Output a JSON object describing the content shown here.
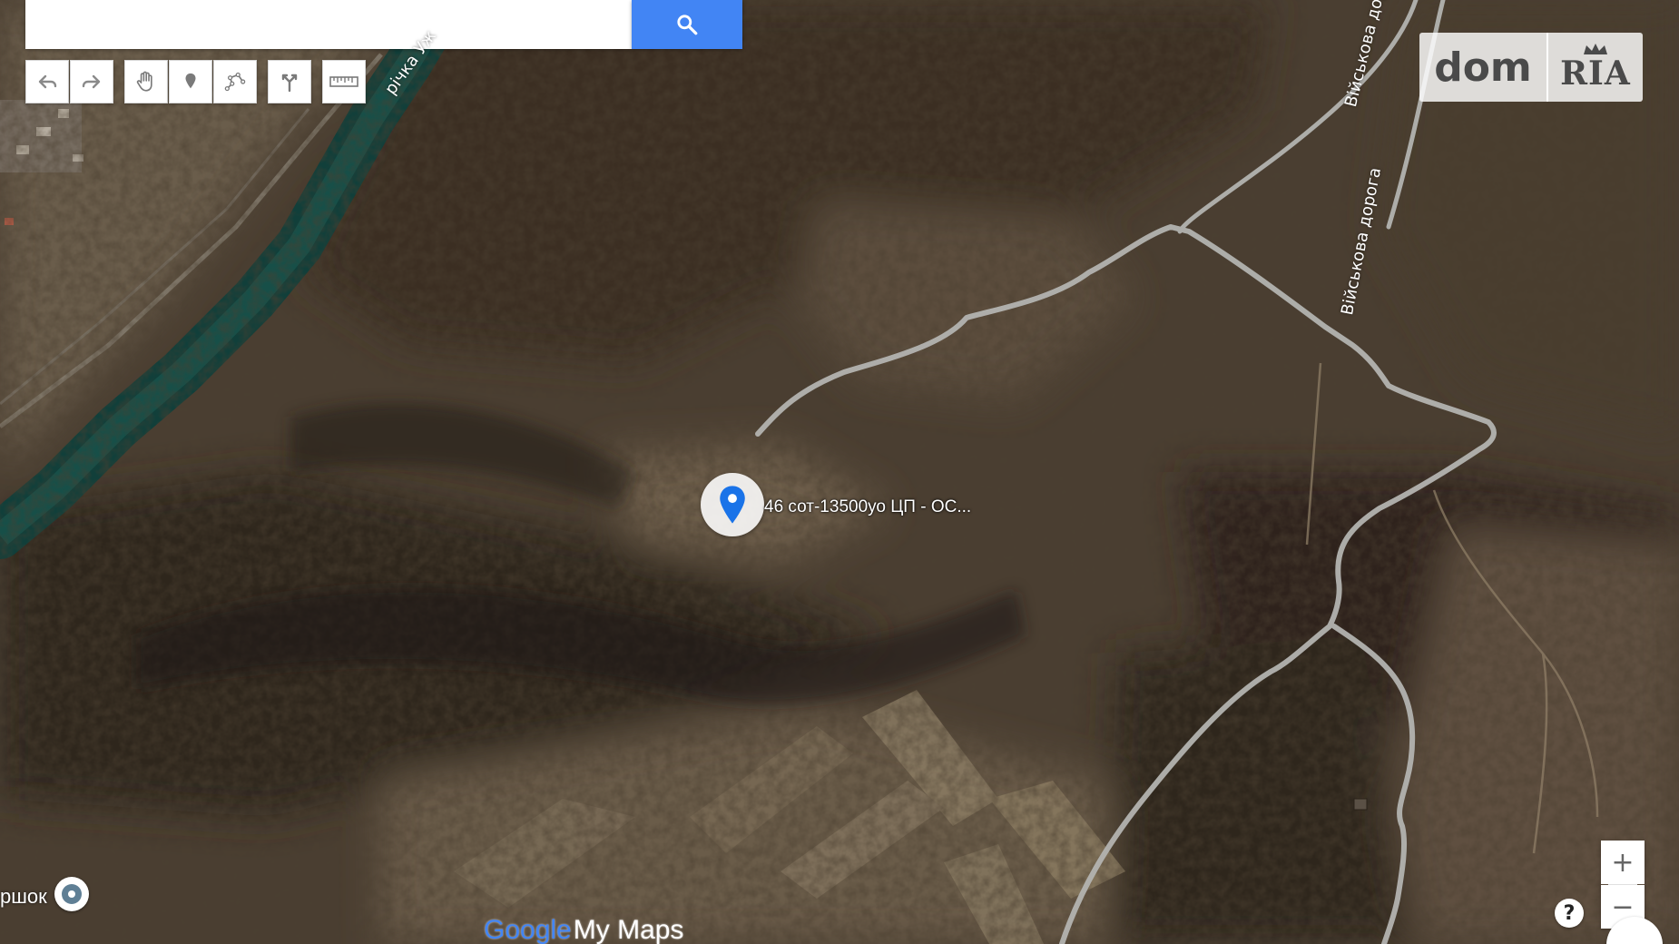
{
  "search": {
    "value": "",
    "placeholder": ""
  },
  "toolbar": {
    "buttons": [
      {
        "name": "undo",
        "icon": "undo-arrow-icon"
      },
      {
        "name": "redo",
        "icon": "redo-arrow-icon"
      },
      {
        "name": "pan",
        "icon": "hand-icon"
      },
      {
        "name": "add-marker",
        "icon": "marker-icon"
      },
      {
        "name": "draw-line",
        "icon": "polyline-icon"
      },
      {
        "name": "directions",
        "icon": "directions-icon"
      },
      {
        "name": "measure",
        "icon": "ruler-icon"
      }
    ]
  },
  "logo": {
    "left": "dom",
    "right": "RIA"
  },
  "map": {
    "type": "satellite",
    "labels": {
      "river": "річка Уж",
      "road_upper": "Військова дор",
      "road_lower": "Військова дорога"
    },
    "marker": {
      "caption": "46 сот-13500уо ЦП - ОС...",
      "color": "#1a73e8"
    },
    "place_label": "ршок"
  },
  "brand": {
    "google": "Google",
    "product": "My Maps"
  },
  "controls": {
    "zoom_in": "+",
    "zoom_out": "−",
    "help": "?"
  },
  "colors": {
    "search_button": "#4285f4",
    "road": "#b9b9b9",
    "river": "#0f4a45"
  }
}
